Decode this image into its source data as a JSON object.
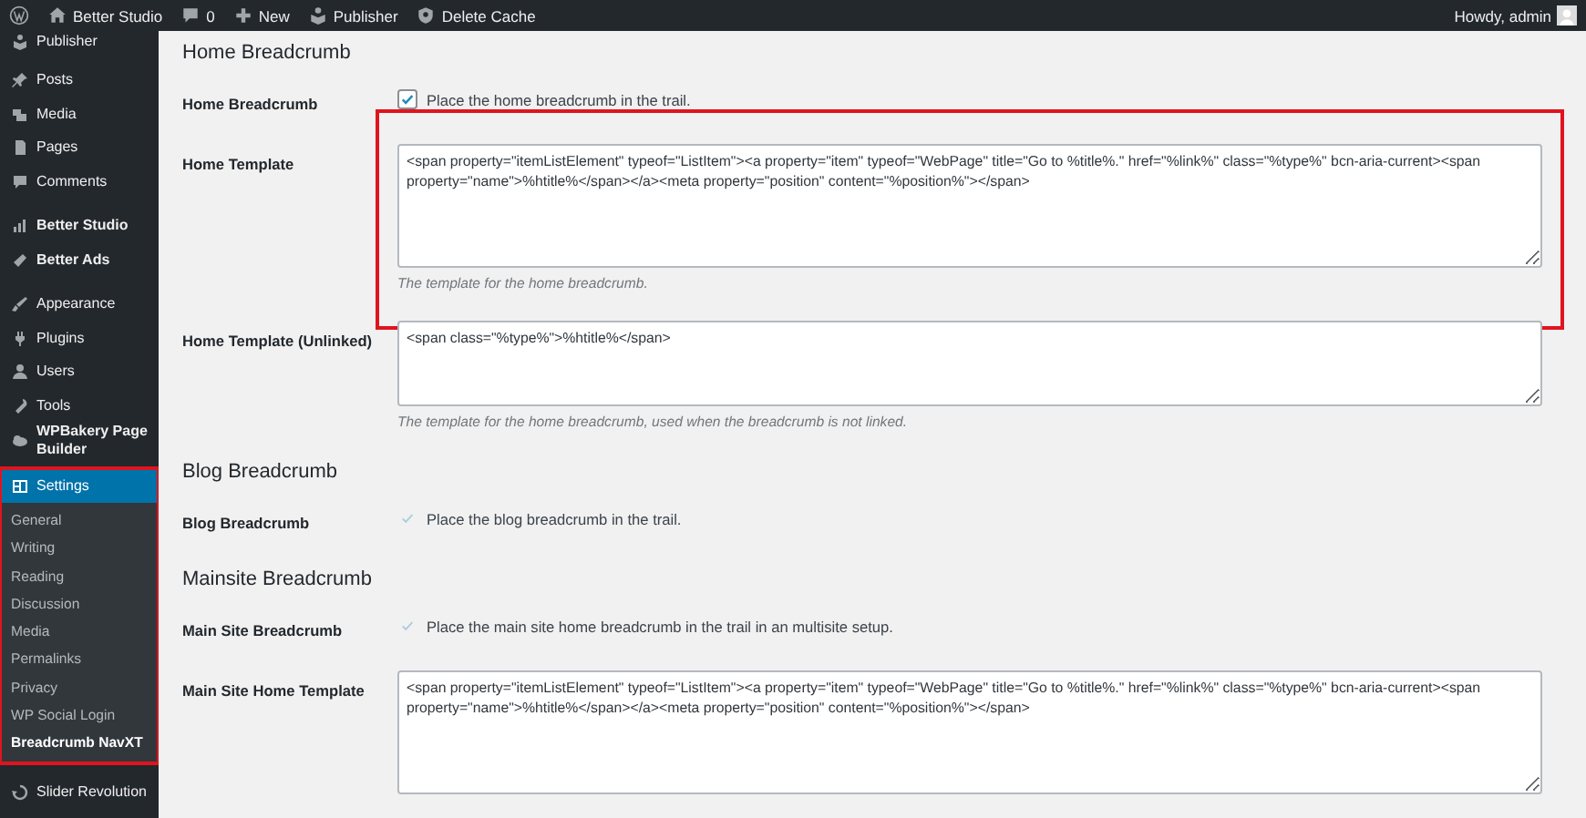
{
  "admin_bar": {
    "items": [
      {
        "kind": "logo"
      },
      {
        "kind": "site",
        "label": "Better Studio"
      },
      {
        "kind": "comments",
        "label": "0"
      },
      {
        "kind": "new",
        "label": "New"
      },
      {
        "kind": "publisher",
        "label": "Publisher"
      },
      {
        "kind": "cache",
        "label": "Delete Cache"
      }
    ],
    "account": {
      "label": "Howdy, admin"
    }
  },
  "sidebar": {
    "groups": [
      {
        "items": [
          {
            "label": "Publisher",
            "bold": false,
            "selected": false,
            "highlighted": false
          }
        ]
      },
      {
        "items": [
          {
            "label": "Posts",
            "bold": false,
            "selected": false,
            "highlighted": false
          },
          {
            "label": "Media",
            "bold": false,
            "selected": false,
            "highlighted": false
          },
          {
            "label": "Pages",
            "bold": false,
            "selected": false,
            "highlighted": false
          },
          {
            "label": "Comments",
            "bold": false,
            "selected": false,
            "highlighted": false
          }
        ]
      },
      {
        "items": [
          {
            "label": "Better Studio",
            "bold": true,
            "selected": false,
            "highlighted": false
          },
          {
            "label": "Better Ads",
            "bold": true,
            "selected": false,
            "highlighted": false
          }
        ]
      },
      {
        "items": [
          {
            "label": "Appearance",
            "bold": false,
            "selected": false,
            "highlighted": false
          },
          {
            "label": "Plugins",
            "bold": false,
            "selected": false,
            "highlighted": false
          },
          {
            "label": "Users",
            "bold": false,
            "selected": false,
            "highlighted": false
          },
          {
            "label": "Tools",
            "bold": false,
            "selected": false,
            "highlighted": false
          },
          {
            "label": "WPBakery Page Builder",
            "bold": true,
            "selected": false,
            "highlighted": false
          },
          {
            "label": "Settings",
            "bold": false,
            "selected": true,
            "highlighted": true,
            "children": [
              {
                "label": "General",
                "selected": false
              },
              {
                "label": "Writing",
                "selected": false
              },
              {
                "label": "Reading",
                "selected": false
              },
              {
                "label": "Discussion",
                "selected": false
              },
              {
                "label": "Media",
                "selected": false
              },
              {
                "label": "Permalinks",
                "selected": false
              },
              {
                "label": "Privacy",
                "selected": false
              },
              {
                "label": "WP Social Login",
                "selected": false
              },
              {
                "label": "Breadcrumb NavXT",
                "selected": true
              }
            ]
          }
        ]
      },
      {
        "items": [
          {
            "label": "Slider Revolution",
            "bold": false,
            "selected": false,
            "highlighted": false
          }
        ]
      }
    ]
  },
  "sections": [
    {
      "heading": "Home Breadcrumb",
      "rows": [
        {
          "label": "Home Breadcrumb",
          "kind": "checkbox",
          "checked": true,
          "disabled": false,
          "text": "Place the home breadcrumb in the trail."
        },
        {
          "label": "Home Template",
          "kind": "textarea",
          "highlighted": true,
          "value": "<span property=\"itemListElement\" typeof=\"ListItem\"><a property=\"item\" typeof=\"WebPage\" title=\"Go to %title%.\" href=\"%link%\" class=\"%type%\" bcn-aria-current><span property=\"name\">%htitle%</span></a><meta property=\"position\" content=\"%position%\"></span>",
          "description": "The template for the home breadcrumb."
        },
        {
          "label": "Home Template (Unlinked)",
          "kind": "textarea",
          "highlighted": false,
          "value": "<span class=\"%type%\">%htitle%</span>",
          "description": "The template for the home breadcrumb, used when the breadcrumb is not linked."
        }
      ]
    },
    {
      "heading": "Blog Breadcrumb",
      "rows": [
        {
          "label": "Blog Breadcrumb",
          "kind": "checkbox",
          "checked": true,
          "disabled": true,
          "text": "Place the blog breadcrumb in the trail."
        }
      ]
    },
    {
      "heading": "Mainsite Breadcrumb",
      "rows": [
        {
          "label": "Main Site Breadcrumb",
          "kind": "checkbox",
          "checked": true,
          "disabled": true,
          "text": "Place the main site home breadcrumb in the trail in an multisite setup."
        },
        {
          "label": "Main Site Home Template",
          "kind": "textarea",
          "highlighted": false,
          "value": "<span property=\"itemListElement\" typeof=\"ListItem\"><a property=\"item\" typeof=\"WebPage\" title=\"Go to %title%.\" href=\"%link%\" class=\"%type%\" bcn-aria-current><span property=\"name\">%htitle%</span></a><meta property=\"position\" content=\"%position%\"></span>"
        }
      ]
    }
  ]
}
